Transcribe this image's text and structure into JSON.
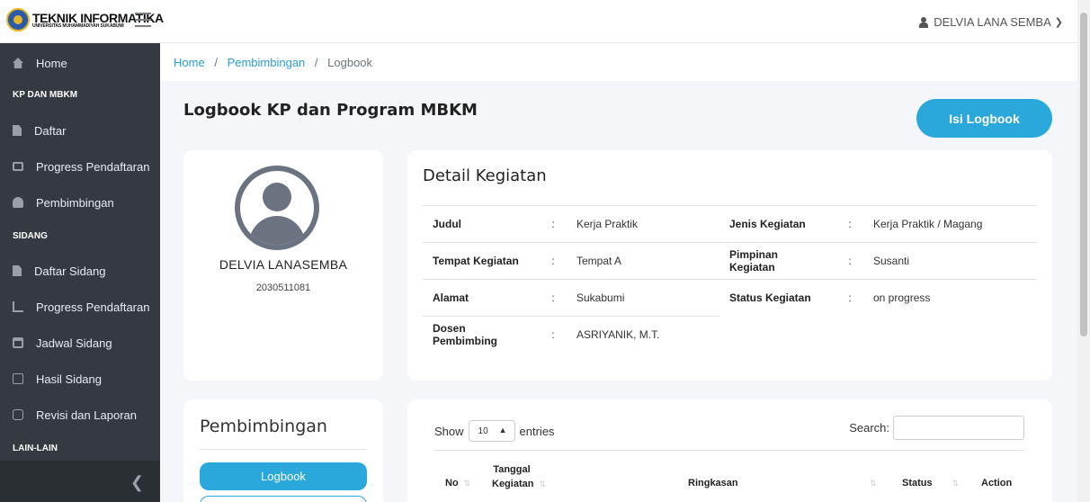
{
  "header": {
    "logo_title": "TEKNIK INFORMATIKA",
    "logo_subtitle": "UNIVERSITAS MUHAMMADIYAH SUKABUMI",
    "user_name": "DELVIA LANA SEMBA"
  },
  "sidebar": {
    "home": "Home",
    "section_kp": "KP DAN MBKM",
    "daftar": "Daftar",
    "progress_pendaftaran": "Progress Pendaftaran",
    "pembimbingan": "Pembimbingan",
    "section_sidang": "SIDANG",
    "daftar_sidang": "Daftar Sidang",
    "progress_pendaftaran_sidang": "Progress Pendaftaran",
    "jadwal_sidang": "Jadwal Sidang",
    "hasil_sidang": "Hasil Sidang",
    "revisi_laporan": "Revisi dan Laporan",
    "section_lain": "LAIN-LAIN"
  },
  "breadcrumb": {
    "home": "Home",
    "pembimbingan": "Pembimbingan",
    "current": "Logbook"
  },
  "main": {
    "title": "Logbook KP dan Program MBKM",
    "isi_button": "Isi Logbook"
  },
  "profile": {
    "name": "DELVIA LANASEMBA",
    "nim": "2030511081"
  },
  "detail": {
    "title": "Detail Kegiatan",
    "judul_label": "Judul",
    "judul_value": "Kerja Praktik",
    "jenis_label": "Jenis Kegiatan",
    "jenis_value": "Kerja Praktik / Magang",
    "tempat_label": "Tempat Kegiatan",
    "tempat_value": "Tempat A",
    "pimpinan_label": "Pimpinan Kegiatan",
    "pimpinan_value": "Susanti",
    "alamat_label": "Alamat",
    "alamat_value": "Sukabumi",
    "status_label": "Status Kegiatan",
    "status_value": "on progress",
    "dosen_label": "Dosen Pembimbing",
    "dosen_value": "ASRIYANIK, M.T.",
    "colon": ":"
  },
  "pembimbingan_card": {
    "title": "Pembimbingan",
    "logbook_button": "Logbook"
  },
  "logbook_table": {
    "show": "Show",
    "entries_value": "10",
    "entries": "entries",
    "search_label": "Search:",
    "col_no": "No",
    "col_tanggal_1": "Tanggal",
    "col_tanggal_2": "Kegiatan",
    "col_ringkasan": "Ringkasan",
    "col_status": "Status",
    "col_action": "Action"
  },
  "colors": {
    "accent": "#2aa8dc",
    "sidebar_bg": "#343a40",
    "link": "#2a9fd6"
  }
}
